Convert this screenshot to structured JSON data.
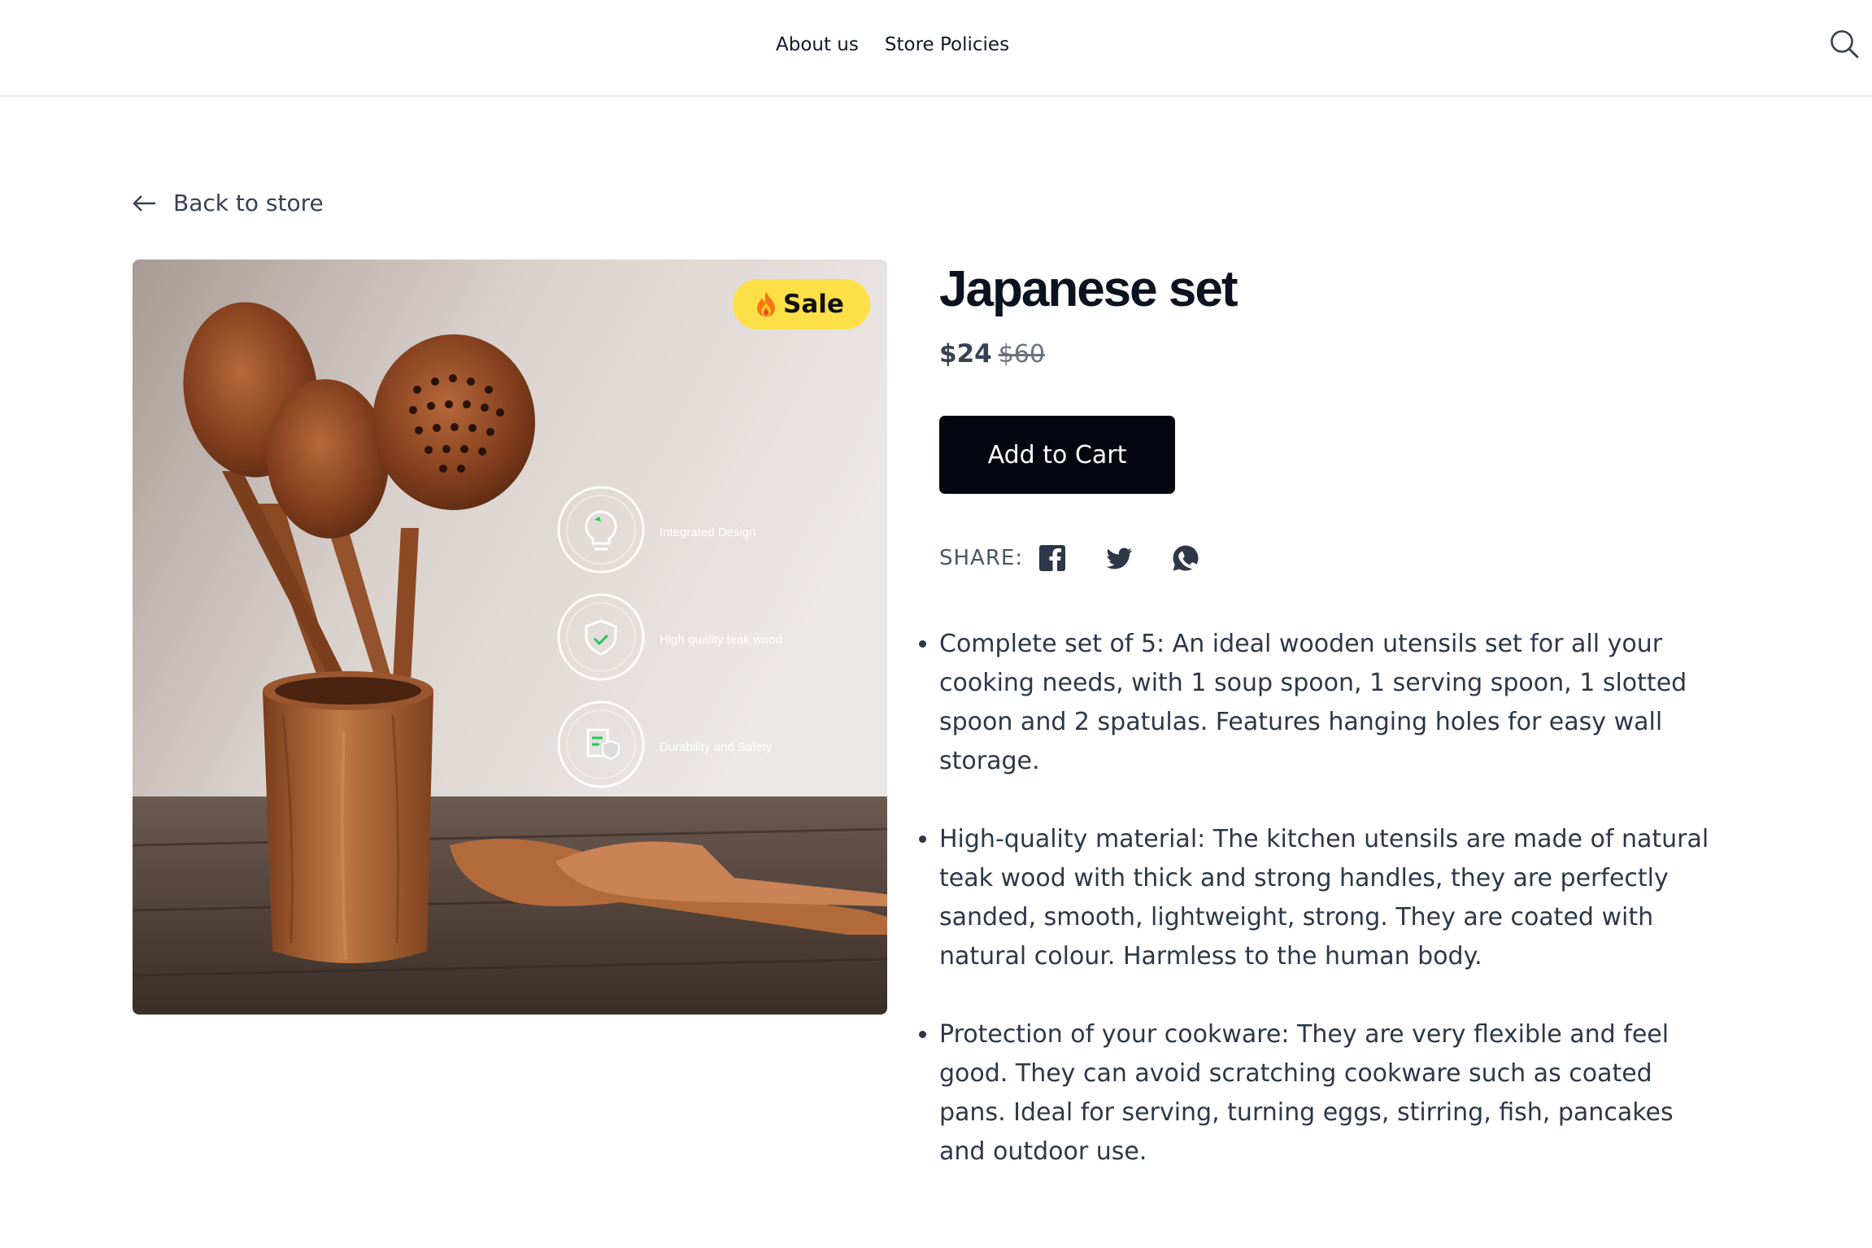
{
  "header": {
    "nav": [
      {
        "label": "About us"
      },
      {
        "label": "Store Policies"
      }
    ],
    "search_icon": "search-icon"
  },
  "back_link": {
    "label": "Back to store",
    "icon": "arrow-left-icon"
  },
  "product": {
    "title": "Japanese set",
    "price": "$24",
    "original_price": "$60",
    "badge": "Sale",
    "badge_icon": "flame-icon",
    "image_overlay": {
      "features": [
        {
          "label": "Integrated Design",
          "icon": "lightbulb-icon"
        },
        {
          "label": "High quality teak wood",
          "icon": "shield-icon"
        },
        {
          "label": "Durability and Safety",
          "icon": "document-shield-icon"
        }
      ]
    },
    "add_to_cart_label": "Add to Cart",
    "share": {
      "label": "SHARE:",
      "networks": [
        {
          "name": "facebook-icon"
        },
        {
          "name": "twitter-icon"
        },
        {
          "name": "whatsapp-icon"
        }
      ]
    },
    "description": [
      "Complete set of 5: An ideal wooden utensils set for all your cooking needs, with 1 soup spoon, 1 serving spoon, 1 slotted spoon and 2 spatulas. Features hanging holes for easy wall storage.",
      "High-quality material: The kitchen utensils are made of natural teak wood with thick and strong handles, they are perfectly sanded, smooth, lightweight, strong. They are coated with natural colour. Harmless to the human body.",
      "Protection of your cookware: They are very flexible and feel good. They can avoid scratching cookware such as coated pans. Ideal for serving, turning eggs, stirring, fish, pancakes and outdoor use."
    ]
  },
  "colors": {
    "badge_bg": "#fde047",
    "button_bg": "#050710",
    "text_dark": "#0b1220",
    "accent_green": "#22c55e"
  }
}
